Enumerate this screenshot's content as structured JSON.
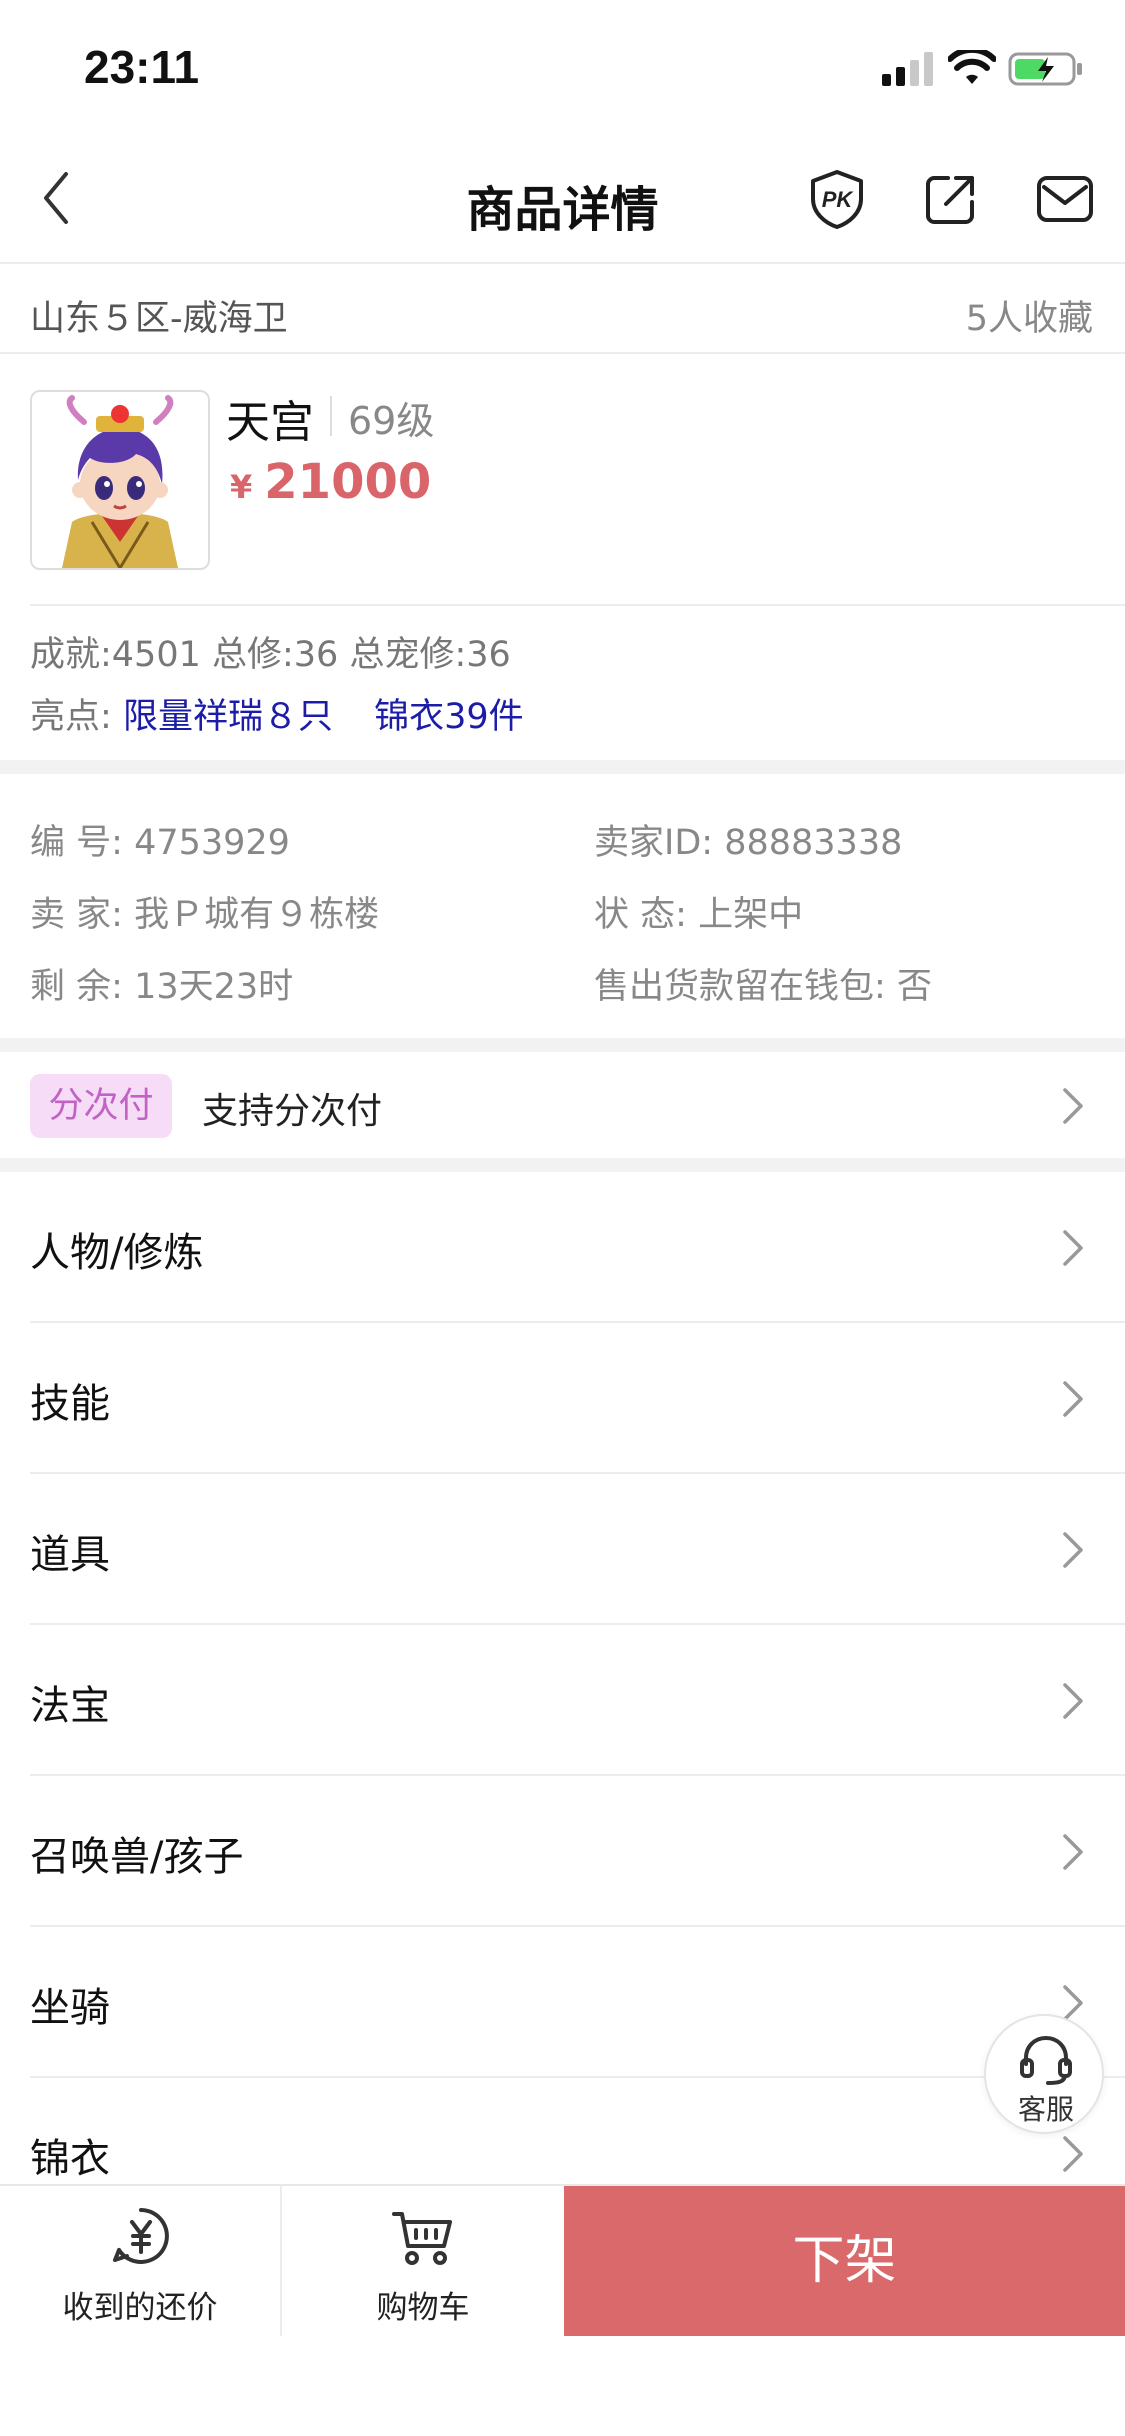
{
  "status_bar": {
    "time": "23:11"
  },
  "nav": {
    "title": "商品详情"
  },
  "listing": {
    "server": "山东５区-威海卫",
    "favorites": "5人收藏"
  },
  "product": {
    "name": "天宫",
    "level": "69级",
    "price_symbol": "¥",
    "price": "21000",
    "stats": "成就:4501 总修:36 总宠修:36",
    "highlight_label": "亮点:",
    "highlights": [
      "限量祥瑞８只",
      "锦衣39件"
    ]
  },
  "info": {
    "id_label": "编  号:",
    "id_value": "4753929",
    "seller_id_label": "卖家ID:",
    "seller_id_value": "88883338",
    "seller_label": "卖  家:",
    "seller_value": "我Ｐ城有９栋楼",
    "status_label": "状  态:",
    "status_value": "上架中",
    "remain_label": "剩  余:",
    "remain_value": "13天23时",
    "wallet_label": "售出货款留在钱包:",
    "wallet_value": "否"
  },
  "installment": {
    "tag": "分次付",
    "text": "支持分次付"
  },
  "menu": [
    "人物/修炼",
    "技能",
    "道具",
    "法宝",
    "召唤兽/孩子",
    "坐骑",
    "锦衣"
  ],
  "customer_service": {
    "label": "客服"
  },
  "bottom_bar": {
    "offers_label": "收到的还价",
    "cart_label": "购物车",
    "delist_label": "下架"
  },
  "colors": {
    "price": "#d9646a",
    "highlight": "#1c1ca8",
    "delist": "#d9696b",
    "install_tag_bg": "#f6dcf6",
    "install_tag_text": "#c063c4"
  }
}
